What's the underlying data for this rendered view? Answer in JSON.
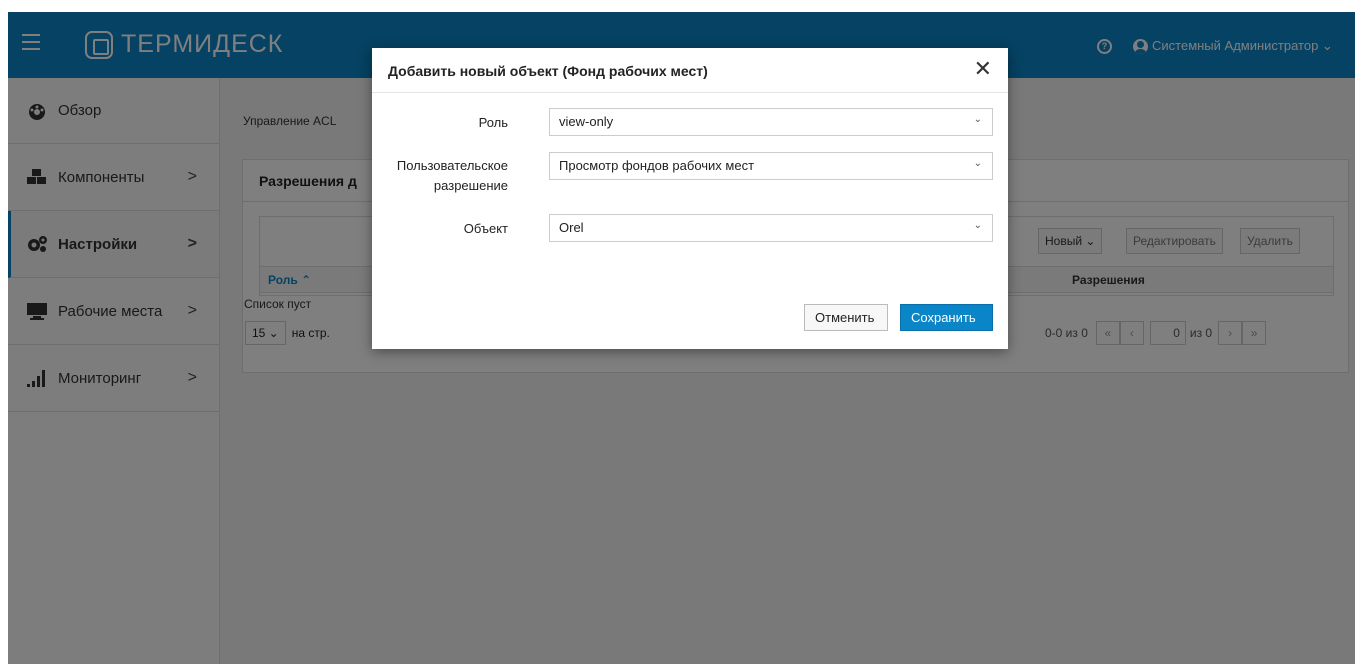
{
  "header": {
    "logo_text": "ТЕРМИДЕСК",
    "help_icon": "?",
    "user_label": "Системный Администратор ⌄"
  },
  "sidebar": {
    "items": [
      {
        "label": "Обзор",
        "icon": "dashboard-icon",
        "chevron": ""
      },
      {
        "label": "Компоненты",
        "icon": "components-icon",
        "chevron": ">"
      },
      {
        "label": "Настройки",
        "icon": "settings-icon",
        "chevron": ">",
        "active": true
      },
      {
        "label": "Рабочие места",
        "icon": "desktop-icon",
        "chevron": ">"
      },
      {
        "label": "Мониторинг",
        "icon": "monitoring-icon",
        "chevron": ">"
      }
    ]
  },
  "main": {
    "breadcrumb": "Управление ACL",
    "panel_title": "Разрешения д",
    "toolbar": {
      "new_label": "Новый ⌄",
      "edit_label": "Редактировать",
      "delete_label": "Удалить"
    },
    "columns": {
      "role": "Роль ⌃",
      "permissions": "Разрешения"
    },
    "empty_text": "Список пуст",
    "page_size": "15 ⌄",
    "per_page_label": "на стр.",
    "pager": {
      "range": "0-0 из 0",
      "first": "«",
      "prev": "‹",
      "page": "0",
      "of_label": "из 0",
      "next": "›",
      "last": "»"
    }
  },
  "modal": {
    "title": "Добавить новый объект (Фонд рабочих мест)",
    "close": "✕",
    "fields": [
      {
        "label": "Роль",
        "value": "view-only"
      },
      {
        "label_line1": "Пользовательское",
        "label_line2": "разрешение",
        "value": "Просмотр фондов рабочих мест"
      },
      {
        "label": "Объект",
        "value": "Orel"
      }
    ],
    "chevron": "⌄",
    "cancel_label": "Отменить",
    "save_label": "Сохранить"
  },
  "colors": {
    "header_bg": "#0a85c7",
    "primary": "#0a85c7"
  }
}
